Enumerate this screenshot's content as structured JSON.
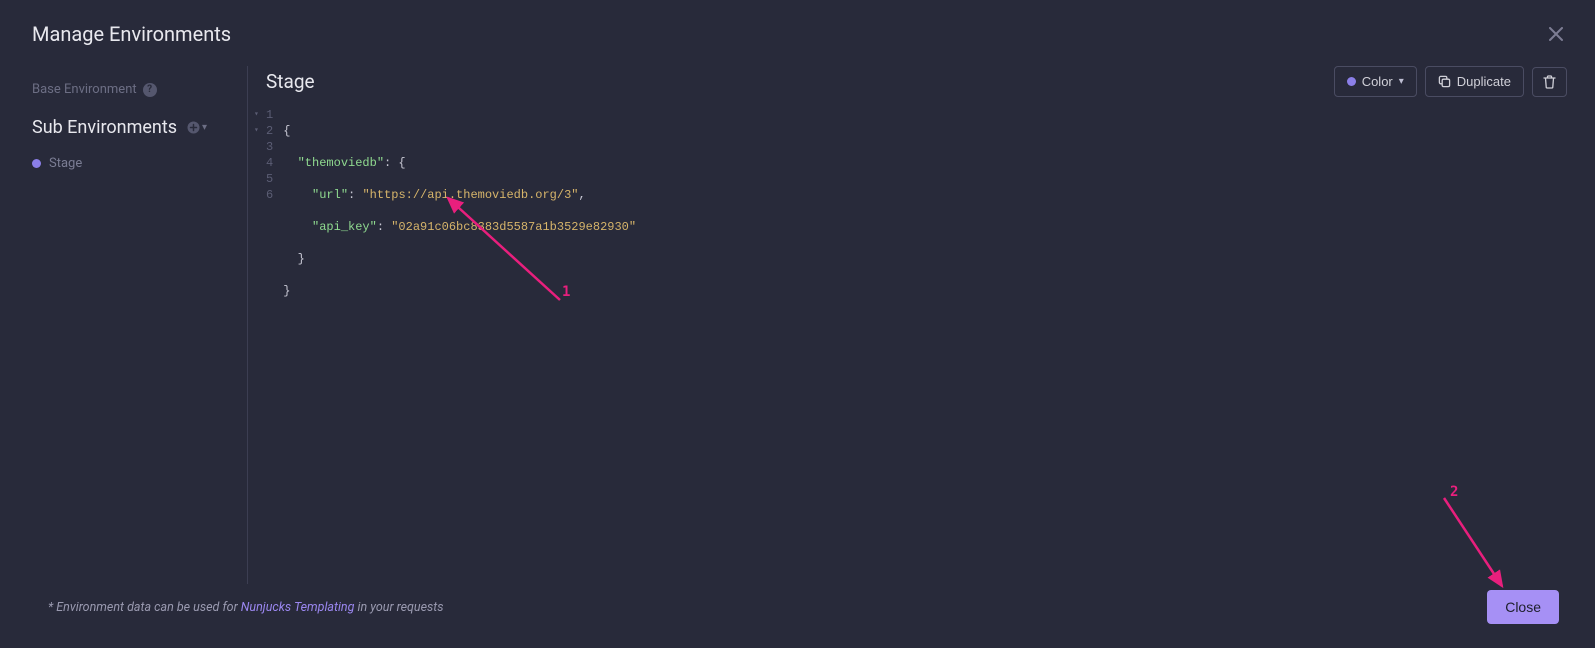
{
  "dialog": {
    "title": "Manage Environments"
  },
  "sidebar": {
    "base_label": "Base Environment",
    "sub_heading": "Sub Environments",
    "items": [
      {
        "label": "Stage",
        "color": "#8b7fe8"
      }
    ]
  },
  "editor": {
    "env_name": "Stage",
    "buttons": {
      "color": "Color",
      "duplicate": "Duplicate"
    },
    "lines": {
      "l1": "{",
      "l2_key": "\"themoviedb\"",
      "l2_rest": ": {",
      "l3_key": "\"url\"",
      "l3_val": "\"https://api.themoviedb.org/3\"",
      "l4_key": "\"api_key\"",
      "l4_val": "\"02a91c06bc8383d5587a1b3529e82930\"",
      "l5": "  }",
      "l6": "}"
    }
  },
  "footer": {
    "prefix": "* Environment data can be used for ",
    "link": "Nunjucks Templating",
    "suffix": " in your requests",
    "close": "Close"
  },
  "annotations": {
    "a1": "1",
    "a2": "2"
  }
}
